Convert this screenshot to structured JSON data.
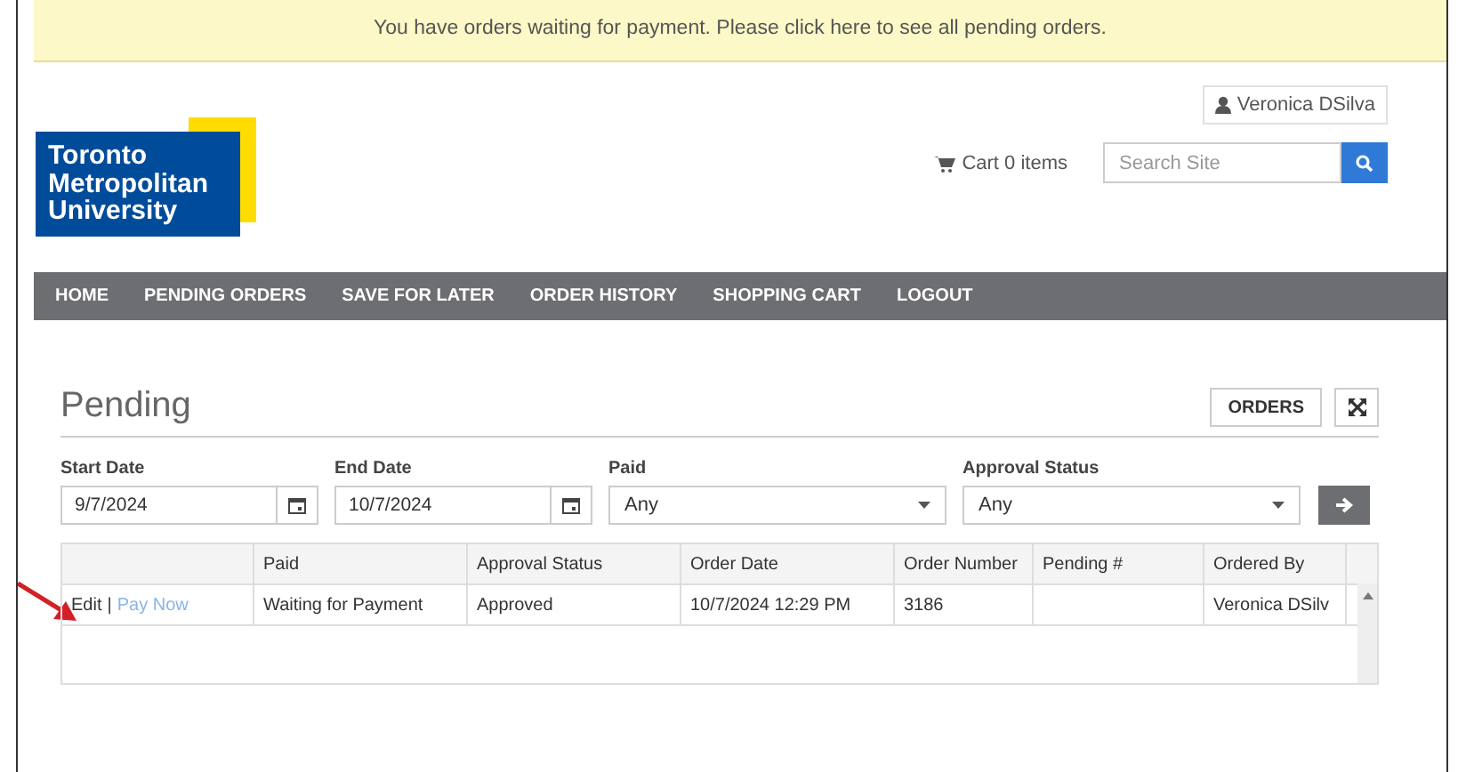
{
  "banner": {
    "text": "You have orders waiting for payment. Please click here to see all pending orders."
  },
  "header": {
    "logo_lines": [
      "Toronto",
      "Metropolitan",
      "University"
    ],
    "user": "Veronica DSilva",
    "cart": "Cart 0 items",
    "search": {
      "placeholder": "Search Site"
    }
  },
  "nav": [
    "HOME",
    "PENDING ORDERS",
    "SAVE FOR LATER",
    "ORDER HISTORY",
    "SHOPPING CART",
    "LOGOUT"
  ],
  "page": {
    "title": "Pending",
    "orders_button": "ORDERS"
  },
  "filters": [
    {
      "kind": "date",
      "label": "Start Date",
      "value": "9/7/2024"
    },
    {
      "kind": "date",
      "label": "End Date",
      "value": "10/7/2024"
    },
    {
      "kind": "select",
      "label": "Paid",
      "value": "Any"
    },
    {
      "kind": "select",
      "label": "Approval Status",
      "value": "Any"
    }
  ],
  "table": {
    "columns": [
      "",
      "Paid",
      "Approval Status",
      "Order Date",
      "Order Number",
      "Pending #",
      "Ordered By"
    ],
    "rows": [
      {
        "cells": [
          {
            "edit": "Edit",
            "separator": "|",
            "pay": "Pay Now"
          },
          "Waiting for Payment",
          "Approved",
          "10/7/2024 12:29 PM",
          "3186",
          "",
          "Veronica DSilv"
        ]
      }
    ]
  }
}
